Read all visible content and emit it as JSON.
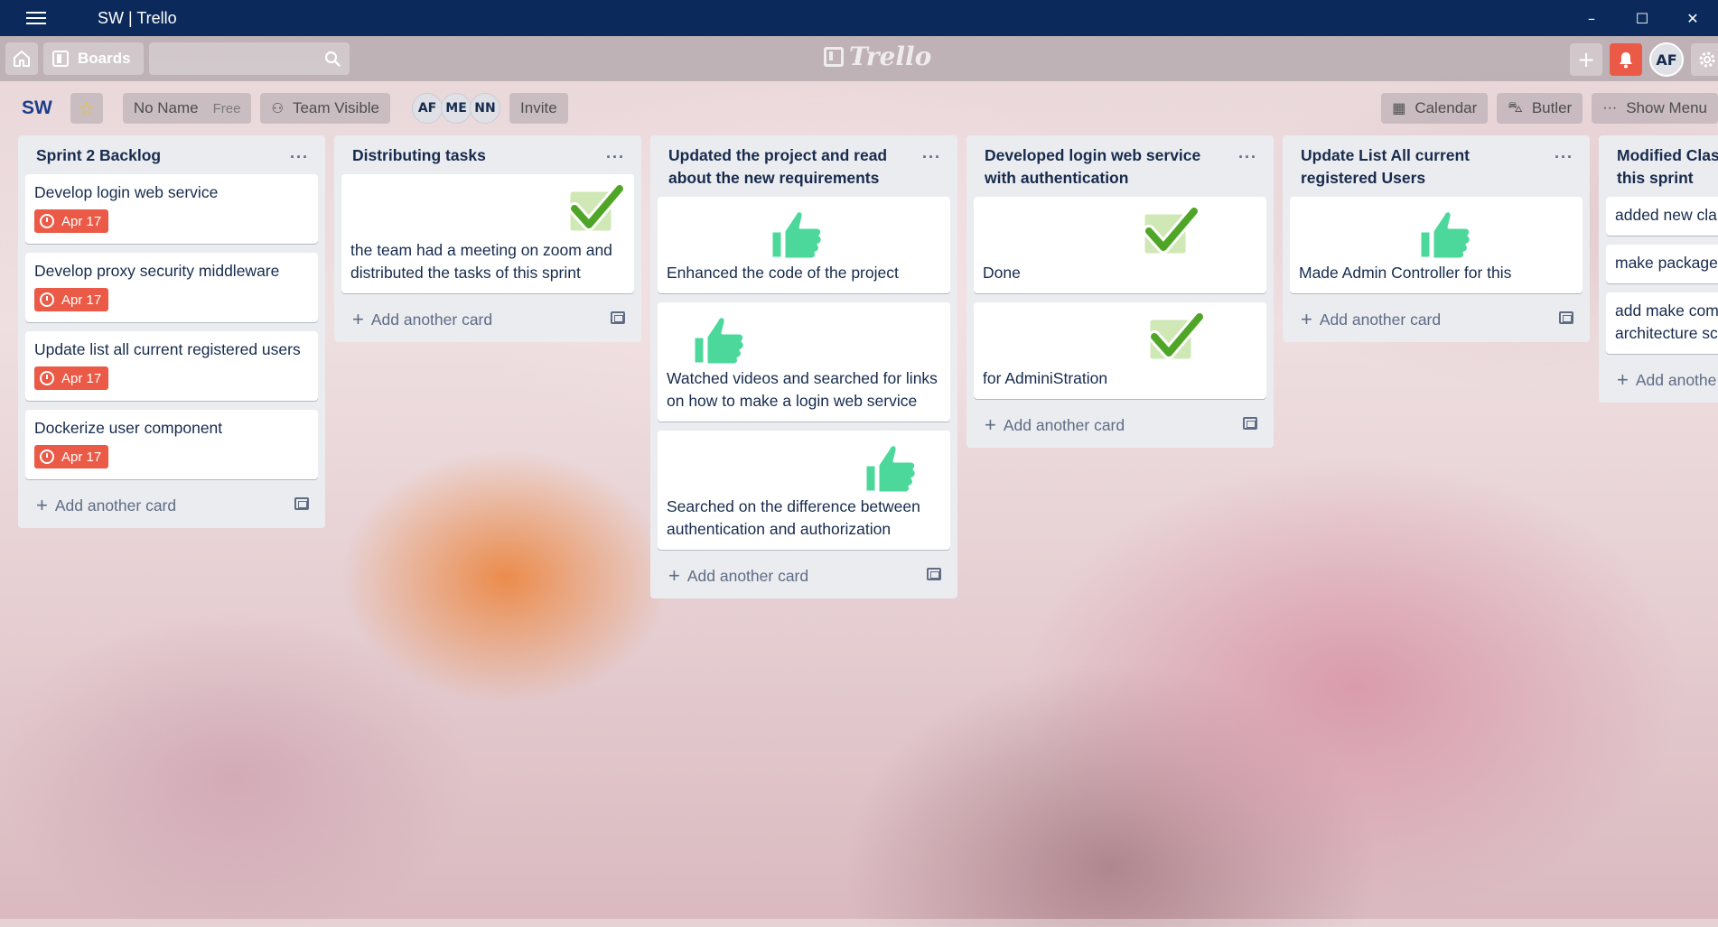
{
  "window": {
    "title": "SW | Trello",
    "controls": {
      "minimize": "–",
      "maximize": "☐",
      "close": "✕"
    }
  },
  "header": {
    "boards_label": "Boards",
    "logo_text": "Trello",
    "avatar_initials": "AF",
    "icons": [
      "home-icon",
      "boards-icon",
      "search-icon",
      "plus-icon",
      "bell-icon",
      "gear-icon"
    ],
    "colors": {
      "bell_bg": "#eb5a46",
      "titlebar_bg": "#0b2a5b"
    }
  },
  "board": {
    "name": "SW",
    "team_name": "No Name",
    "team_plan": "Free",
    "visibility": "Team Visible",
    "members": [
      "AF",
      "ME",
      "NN"
    ],
    "invite_label": "Invite",
    "calendar_label": "Calendar",
    "butler_label": "Butler",
    "show_menu_label": "Show Menu"
  },
  "lists": [
    {
      "title": "Sprint 2 Backlog",
      "menu": "···",
      "cards": [
        {
          "title": "Develop login web service",
          "due": "Apr 17"
        },
        {
          "title": "Develop proxy security middleware",
          "due": "Apr 17"
        },
        {
          "title": "Update list all current registered users",
          "due": "Apr 17"
        },
        {
          "title": "Dockerize user component",
          "due": "Apr 17"
        }
      ],
      "add_label": "Add another card"
    },
    {
      "title": "Distributing tasks",
      "menu": "···",
      "cards": [
        {
          "title": "the team had a meeting on zoom and distributed the tasks of this sprint",
          "sticker": "check"
        }
      ],
      "add_label": "Add another card"
    },
    {
      "title": "Updated the project and read about the new requirements",
      "menu": "···",
      "cards": [
        {
          "title": "Enhanced the code of the project",
          "sticker": "thumbsup"
        },
        {
          "title": "Watched videos and searched for links on how to make a login web service",
          "sticker": "thumbsup"
        },
        {
          "title": "Searched on the difference between authentication and authorization",
          "sticker": "thumbsup"
        }
      ],
      "add_label": "Add another card"
    },
    {
      "title": "Developed login web service with authentication",
      "menu": "···",
      "cards": [
        {
          "title": "Done",
          "sticker": "check"
        },
        {
          "title": "for AdminiStration",
          "sticker": "check"
        }
      ],
      "add_label": "Add another card"
    },
    {
      "title": "Update List All current registered Users",
      "menu": "···",
      "cards": [
        {
          "title": "Made Admin Controller for this",
          "sticker": "thumbsup"
        }
      ],
      "add_label": "Add another card"
    },
    {
      "title": "Modified Class this sprint",
      "cards": [
        {
          "title": "added new cla"
        },
        {
          "title": "make package"
        },
        {
          "title": "add make com architecture sc"
        }
      ],
      "add_label": "Add anothe"
    }
  ]
}
